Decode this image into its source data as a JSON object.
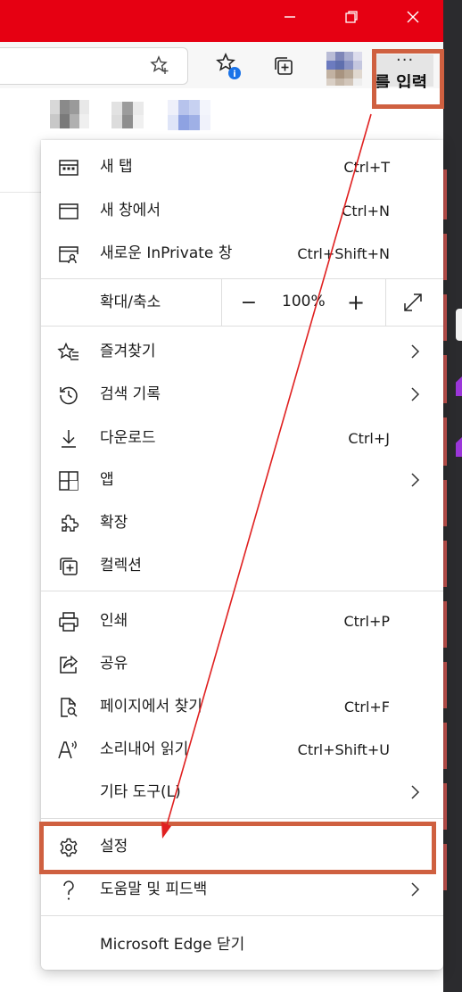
{
  "window": {
    "accent_color": "#e60012",
    "minimize_icon": "minimize-icon",
    "restore_icon": "restore-icon",
    "close_icon": "close-icon"
  },
  "toolbar": {
    "favorite_icon": "star-plus-icon",
    "favorites_icon": "favorites-star-icon",
    "collections_icon": "collections-icon",
    "more_dots": "···",
    "search_peek": "를 입력"
  },
  "menu": {
    "items_top": [
      {
        "icon": "new-tab-icon",
        "label": "새 탭",
        "shortcut": "Ctrl+T"
      },
      {
        "icon": "new-window-icon",
        "label": "새 창에서",
        "shortcut": "Ctrl+N"
      },
      {
        "icon": "inprivate-icon",
        "label": "새로운 InPrivate 창",
        "shortcut": "Ctrl+Shift+N"
      }
    ],
    "zoom": {
      "label": "확대/축소",
      "minus": "−",
      "value": "100%",
      "plus": "+"
    },
    "items_mid": [
      {
        "icon": "favorites-icon",
        "label": "즐겨찾기",
        "shortcut": "",
        "chevron": true
      },
      {
        "icon": "history-icon",
        "label": "검색 기록",
        "shortcut": "",
        "chevron": true
      },
      {
        "icon": "download-icon",
        "label": "다운로드",
        "shortcut": "Ctrl+J",
        "chevron": false
      },
      {
        "icon": "apps-icon",
        "label": "앱",
        "shortcut": "",
        "chevron": true
      },
      {
        "icon": "extensions-icon",
        "label": "확장",
        "shortcut": "",
        "chevron": false
      },
      {
        "icon": "collections-icon",
        "label": "컬렉션",
        "shortcut": "",
        "chevron": false
      }
    ],
    "items_bottom": [
      {
        "icon": "print-icon",
        "label": "인쇄",
        "shortcut": "Ctrl+P",
        "chevron": false
      },
      {
        "icon": "share-icon",
        "label": "공유",
        "shortcut": "",
        "chevron": false
      },
      {
        "icon": "find-icon",
        "label": "페이지에서 찾기",
        "shortcut": "Ctrl+F",
        "chevron": false
      },
      {
        "icon": "read-aloud-icon",
        "label": "소리내어 읽기",
        "shortcut": "Ctrl+Shift+U",
        "chevron": false
      },
      {
        "icon": "",
        "label": "기타 도구(L)",
        "shortcut": "",
        "chevron": true
      }
    ],
    "settings": {
      "icon": "gear-icon",
      "label": "설정"
    },
    "help": {
      "icon": "help-icon",
      "label": "도움말 및 피드백",
      "chevron": true
    },
    "close_edge": {
      "label": "Microsoft Edge 닫기"
    }
  },
  "annotation": {
    "color": "#cf6040",
    "arrow_color": "#e02020"
  }
}
